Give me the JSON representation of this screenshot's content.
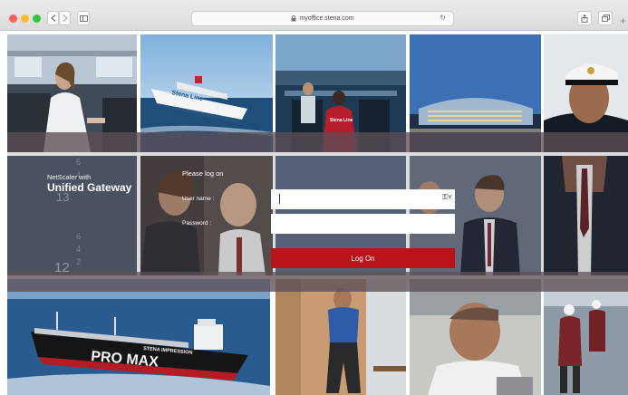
{
  "browser": {
    "url": "myoffice.stena.com",
    "reload_glyph": "↻",
    "new_tab_glyph": "+"
  },
  "branding": {
    "product_line1": "NetScaler with",
    "product_line2": "Unified Gateway"
  },
  "login": {
    "title": "Please log on",
    "username_label": "User name :",
    "username_value": "",
    "password_label": "Password :",
    "password_value": "",
    "submit_label": "Log On"
  },
  "photo_text": {
    "ferry_livery": "Stena Line",
    "crew_shirt": "Stena Line",
    "numbers_upper": "13",
    "numbers_lower": "12",
    "tanker_name": "STENA IMPRESSION",
    "tanker_hull": "PRO MAX"
  }
}
